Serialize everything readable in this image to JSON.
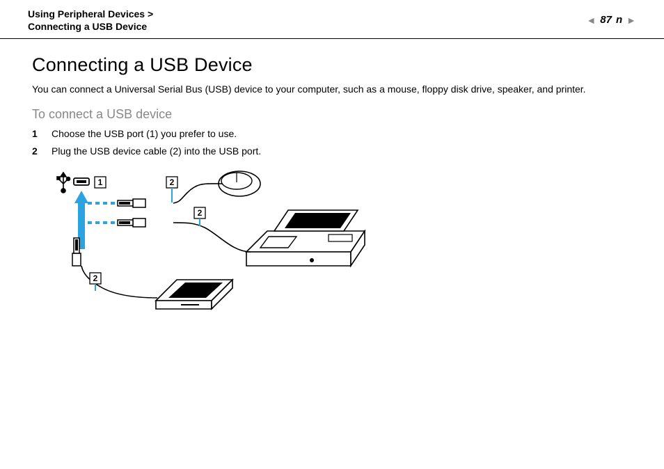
{
  "header": {
    "breadcrumb_line1": "Using Peripheral Devices >",
    "breadcrumb_line2": "Connecting a USB Device",
    "page_number": "87",
    "prev_label": "◄",
    "page_label_n": "n",
    "next_label": "►"
  },
  "main": {
    "title": "Connecting a USB Device",
    "intro": "You can connect a Universal Serial Bus (USB) device to your computer, such as a mouse, floppy disk drive, speaker, and printer.",
    "subhead": "To connect a USB device",
    "steps": [
      "Choose the USB port (1) you prefer to use.",
      "Plug the USB device cable (2) into the USB port."
    ]
  },
  "illustration": {
    "callouts": {
      "port": "1",
      "cable_a": "2",
      "cable_b": "2",
      "cable_c": "2"
    }
  }
}
